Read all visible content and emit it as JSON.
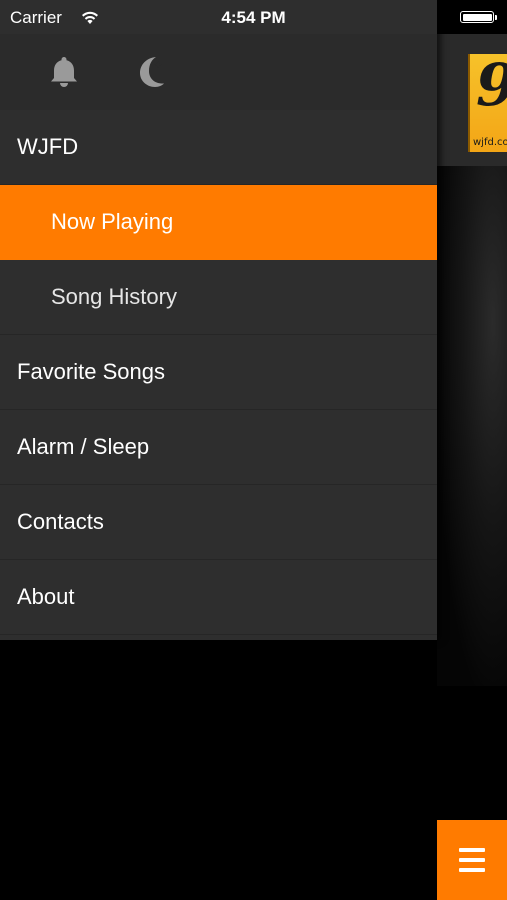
{
  "status_bar": {
    "carrier": "Carrier",
    "time": "4:54 PM"
  },
  "drawer": {
    "icons": [
      "bell-icon",
      "moon-icon"
    ],
    "items": [
      {
        "label": "WJFD",
        "level": "top",
        "active": false
      },
      {
        "label": "Now Playing",
        "level": "sub",
        "active": true
      },
      {
        "label": "Song History",
        "level": "sub",
        "active": false
      },
      {
        "label": "Favorite Songs",
        "level": "top",
        "active": false
      },
      {
        "label": "Alarm / Sleep",
        "level": "top",
        "active": false
      },
      {
        "label": "Contacts",
        "level": "top",
        "active": false
      },
      {
        "label": "About",
        "level": "top",
        "active": false
      }
    ]
  },
  "logo": {
    "number": "9",
    "url": "wjfd.co"
  },
  "colors": {
    "accent": "#ff7b00",
    "drawer_bg": "#2e2e2e"
  },
  "menu_button": {
    "icon": "hamburger-icon"
  }
}
